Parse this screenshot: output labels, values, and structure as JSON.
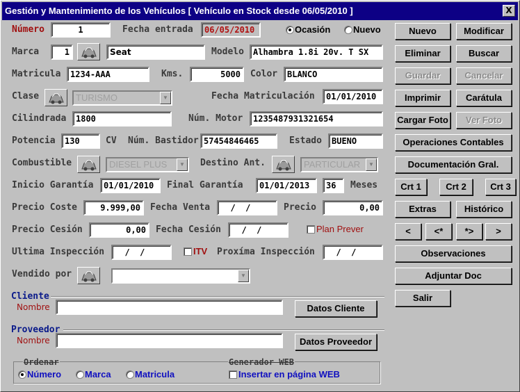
{
  "window": {
    "title": "Gestión y Mantenimiento de los Vehículos [ Vehículo en Stock desde 06/05/2010 ]",
    "close_label": "X"
  },
  "form": {
    "numero": {
      "label": "Número",
      "value": "1"
    },
    "fecha_entrada": {
      "label": "Fecha entrada",
      "value": "06/05/2010"
    },
    "ocasion_label": "Ocasión",
    "nuevo_label": "Nuevo",
    "marca": {
      "label": "Marca",
      "code": "1",
      "name": "Seat"
    },
    "modelo": {
      "label": "Modelo",
      "value": "Alhambra 1.8i 20v. T SX"
    },
    "matricula": {
      "label": "Matricula",
      "value": "1234-AAA"
    },
    "kms": {
      "label": "Kms.",
      "value": "5000"
    },
    "color": {
      "label": "Color",
      "value": "BLANCO"
    },
    "clase": {
      "label": "Clase",
      "value": "TURISMO"
    },
    "fecha_matriculacion": {
      "label": "Fecha Matriculación",
      "value": "01/01/2010"
    },
    "cilindrada": {
      "label": "Cilindrada",
      "value": "1800"
    },
    "num_motor": {
      "label": "Núm. Motor",
      "value": "1235487931321654"
    },
    "potencia": {
      "label": "Potencia",
      "value": "130",
      "unit": "CV"
    },
    "num_bastidor": {
      "label": "Núm. Bastidor",
      "value": "57454846465"
    },
    "estado": {
      "label": "Estado",
      "value": "BUENO"
    },
    "combustible": {
      "label": "Combustible",
      "value": "DIESEL PLUS"
    },
    "destino_ant": {
      "label": "Destino Ant.",
      "value": "PARTICULAR"
    },
    "inicio_garantia": {
      "label": "Inicio Garantía",
      "value": "01/01/2010"
    },
    "final_garantia": {
      "label": "Final Garantía",
      "value": "01/01/2013"
    },
    "meses": {
      "label": "Meses",
      "value": "36"
    },
    "precio_coste": {
      "label": "Precio Coste",
      "value": "9.999,00"
    },
    "fecha_venta": {
      "label": "Fecha Venta",
      "value": "  /  /"
    },
    "precio": {
      "label": "Precio",
      "value": "0,00"
    },
    "precio_cesion": {
      "label": "Precio Cesión",
      "value": "0,00"
    },
    "fecha_cesion": {
      "label": "Fecha Cesión",
      "value": "  /  /"
    },
    "plan_prever_label": "Plan Prever",
    "ultima_inspeccion": {
      "label": "Ultima Inspección",
      "value": "  /  /"
    },
    "itv_label": "ITV",
    "proxima_inspeccion": {
      "label": "Proxíma Inspección",
      "value": "  /  /"
    },
    "vendido_por": {
      "label": "Vendido por",
      "value": ""
    },
    "cliente": {
      "section": "Cliente",
      "label": "Nombre",
      "value": "",
      "button": "Datos Cliente"
    },
    "proveedor": {
      "section": "Proveedor",
      "label": "Nombre",
      "value": "",
      "button": "Datos Proveedor"
    },
    "ordenar": {
      "title": "Ordenar",
      "options": [
        "Número",
        "Marca",
        "Matricula"
      ],
      "selected": "Número"
    },
    "generador": {
      "title": "Generador WEB",
      "checkbox_label": "Insertar en página WEB"
    }
  },
  "buttons": {
    "nuevo": "Nuevo",
    "modificar": "Modificar",
    "eliminar": "Eliminar",
    "buscar": "Buscar",
    "guardar": "Guardar",
    "cancelar": "Cancelar",
    "imprimir": "Imprimir",
    "caratula": "Carátula",
    "cargar_foto": "Cargar Foto",
    "ver_foto": "Ver Foto",
    "operaciones": "Operaciones Contables",
    "documentacion": "Documentación Gral.",
    "crt1": "Crt 1",
    "crt2": "Crt 2",
    "crt3": "Crt 3",
    "extras": "Extras",
    "historico": "Histórico",
    "nav_first": "<",
    "nav_prev": "<*",
    "nav_next": "*>",
    "nav_last": ">",
    "observaciones": "Observaciones",
    "adjuntar": "Adjuntar Doc",
    "salir": "Salir"
  }
}
